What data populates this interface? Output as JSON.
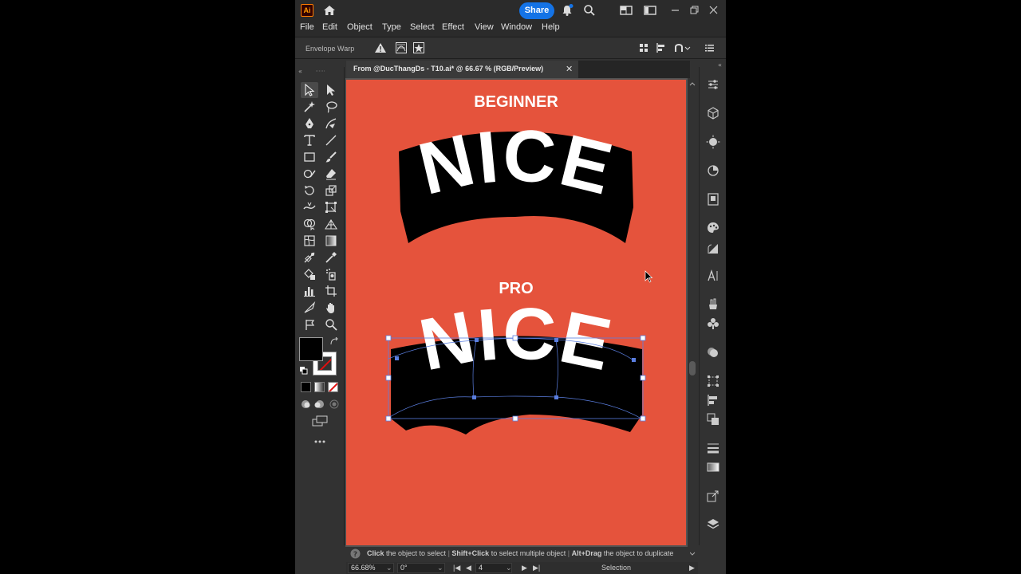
{
  "app": {
    "logo_text": "Ai",
    "share_label": "Share"
  },
  "menu": [
    "File",
    "Edit",
    "Object",
    "Type",
    "Select",
    "Effect",
    "View",
    "Window",
    "Help"
  ],
  "control_bar": {
    "label": "Envelope Warp"
  },
  "document": {
    "tab_title": "From @DucThangDs - T10.ai* @ 66.67 % (RGB/Preview)"
  },
  "artboard": {
    "background": "#e5533c",
    "heading_top": "BEGINNER",
    "word_top": "NICE",
    "heading_bottom": "PRO",
    "word_bottom": "NICE"
  },
  "hint": {
    "click_bold": "Click",
    "click_text": " the object to select",
    "shift_bold": "Shift+Click",
    "shift_text": " to select multiple object",
    "alt_bold": "Alt+Drag",
    "alt_text": " the object to duplicate"
  },
  "status": {
    "zoom": "66.68%",
    "rotation": "0°",
    "artboard_number": "4",
    "tool_name": "Selection"
  },
  "colors": {
    "accent": "#1473e6",
    "artboard": "#e5533c",
    "app_bg": "#323232"
  }
}
